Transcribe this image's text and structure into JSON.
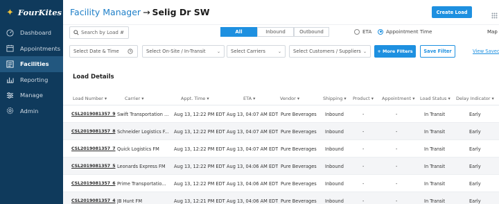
{
  "brand": {
    "name": "FourKites"
  },
  "sidebar": {
    "items": [
      {
        "label": "Dashboard",
        "icon": "dashboard-icon",
        "active": false
      },
      {
        "label": "Appointments",
        "icon": "calendar-icon",
        "active": false
      },
      {
        "label": "Facilities",
        "icon": "facility-icon",
        "active": true
      },
      {
        "label": "Reporting",
        "icon": "bar-chart-icon",
        "active": false
      },
      {
        "label": "Manage",
        "icon": "sliders-icon",
        "active": false
      },
      {
        "label": "Admin",
        "icon": "gear-icon",
        "active": false
      }
    ]
  },
  "header": {
    "title": "Facility Manager",
    "arrow": "→",
    "facility": "Selig Dr SW",
    "create_load": "Create Load"
  },
  "toolbar": {
    "search_placeholder": "Search by Load #",
    "segments": [
      "All",
      "Inbound",
      "Outbound"
    ],
    "active_segment": "All",
    "radio_eta": "ETA",
    "radio_appt": "Appointment Time",
    "radio_selected": "Appointment Time",
    "map": "Map"
  },
  "filters": {
    "date": "Select Date & Time",
    "onsite": "Select On-Site / In-Transit",
    "carriers": "Select Carriers",
    "customers": "Select Customers / Suppliers",
    "more": "+ More Filters",
    "save": "Save Filter",
    "view_saved": "View Saved"
  },
  "section_title": "Load Details",
  "table": {
    "columns": [
      "Load Number",
      "Carrier",
      "Appt. Time",
      "ETA",
      "Vendor",
      "Shipping",
      "Product",
      "Appointment",
      "Load Status",
      "Delay Indicator"
    ],
    "rows": [
      [
        "CSL2019081357_9",
        "Swift Transportation ...",
        "Aug 13, 12:22 PM EDT",
        "Aug 13, 04:07 AM EDT",
        "Pure Beverages",
        "Inbound",
        "-",
        "-",
        "In Transit",
        "Early"
      ],
      [
        "CSL2019081357_8",
        "Schneider Logistics F...",
        "Aug 13, 12:22 PM EDT",
        "Aug 13, 04:07 AM EDT",
        "Pure Beverages",
        "Inbound",
        "-",
        "-",
        "In Transit",
        "Early"
      ],
      [
        "CSL2019081357_7",
        "Quick Logistics FM",
        "Aug 13, 12:22 PM EDT",
        "Aug 13, 04:07 AM EDT",
        "Pure Beverages",
        "Inbound",
        "-",
        "-",
        "In Transit",
        "Early"
      ],
      [
        "CSL2019081357_5",
        "Leonards Express FM",
        "Aug 13, 12:22 PM EDT",
        "Aug 13, 04:06 AM EDT",
        "Pure Beverages",
        "Inbound",
        "-",
        "-",
        "In Transit",
        "Early"
      ],
      [
        "CSL2019081357_6",
        "Prime Transportatio...",
        "Aug 13, 12:22 PM EDT",
        "Aug 13, 04:06 AM EDT",
        "Pure Beverages",
        "Inbound",
        "-",
        "-",
        "In Transit",
        "Early"
      ],
      [
        "CSL2019081357_4",
        "JB Hunt FM",
        "Aug 13, 12:21 PM EDT",
        "Aug 13, 04:06 AM EDT",
        "Pure Beverages",
        "Inbound",
        "-",
        "-",
        "In Transit",
        "Early"
      ]
    ]
  },
  "colors": {
    "sidebar": "#0f3a5c",
    "accent": "#1e90e0",
    "active_nav": "#22577f"
  }
}
